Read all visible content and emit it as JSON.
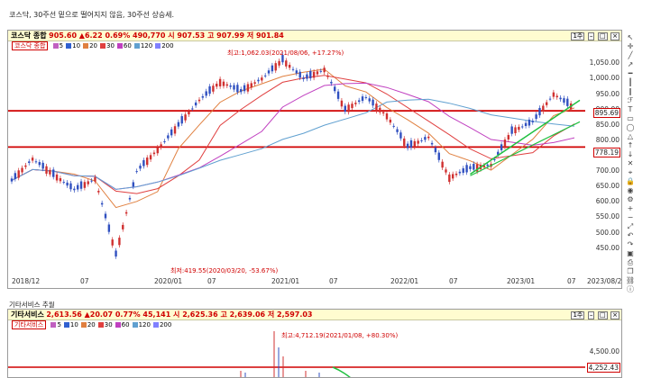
{
  "caption": "코스닥, 30주선 밑으로 떨어지지 않음, 30주선 상승세.",
  "main_chart": {
    "title": "코스닥 종합",
    "quote": "905.60 ▲6.22 0.69% 490,770 시 907.53 고 907.99 저 901.84",
    "period_label": "1주",
    "legend_name": "코스닥 종합",
    "ma_legend": [
      {
        "label": "5",
        "color": "#c060c0"
      },
      {
        "label": "10",
        "color": "#3060d0"
      },
      {
        "label": "20",
        "color": "#e08040"
      },
      {
        "label": "30",
        "color": "#e04040"
      },
      {
        "label": "60",
        "color": "#c040c0"
      },
      {
        "label": "120",
        "color": "#60a0d0"
      },
      {
        "label": "200",
        "color": "#8080ff"
      }
    ],
    "y_ticks": [
      "1,050.00",
      "1,000.00",
      "950.00",
      "900.00",
      "850.00",
      "800.00",
      "750.00",
      "700.00",
      "650.00",
      "600.00",
      "550.00",
      "500.00",
      "450.00"
    ],
    "x_ticks": [
      "2018/12",
      "07",
      "2020/01",
      "07",
      "2021/01",
      "07",
      "2022/01",
      "07",
      "2023/01",
      "07",
      "2023/08/28"
    ],
    "price_label": "895.69",
    "line_label": "778.19",
    "high_annotation": "최고:1,062.03(2021/08/06, +17.27%)",
    "low_annotation": "최저:419.55(2020/03/20, -53.67%)"
  },
  "sub_caption": "기타서비스 추월",
  "sub_chart": {
    "title": "기타서비스",
    "quote": "2,613.56 ▲20.07 0.77% 45,141 시 2,625.36 고 2,639.06 저 2,597.03",
    "period_label": "1주",
    "legend_name": "기타서비스",
    "y_ticks": [
      "4,500.00"
    ],
    "price_label": "4,252.43",
    "high_annotation": "최고:4,712.19(2021/01/08, +80.30%)"
  },
  "chart_data": {
    "type": "line",
    "title": "코스닥 종합",
    "x": [
      "2018/12",
      "2019/03",
      "2019/07",
      "2019/10",
      "2020/01",
      "2020/03",
      "2020/05",
      "2020/07",
      "2020/09",
      "2020/12",
      "2021/01",
      "2021/03",
      "2021/05",
      "2021/08",
      "2021/10",
      "2021/12",
      "2022/01",
      "2022/03",
      "2022/05",
      "2022/07",
      "2022/09",
      "2022/10",
      "2022/12",
      "2023/01",
      "2023/03",
      "2023/05",
      "2023/07",
      "2023/08"
    ],
    "series": [
      {
        "name": "코스닥 종합",
        "values": [
          670,
          740,
          690,
          640,
          675,
          430,
          700,
          770,
          850,
          930,
          990,
          960,
          1000,
          1062,
          1000,
          1030,
          900,
          940,
          880,
          780,
          810,
          680,
          710,
          720,
          830,
          860,
          950,
          905
        ]
      }
    ],
    "ylim": [
      420,
      1080
    ],
    "hlines": [
      895.69,
      778.19
    ],
    "grid": false
  },
  "toolbar_icons": [
    "arrow-icon",
    "crosshair-icon",
    "line-icon",
    "trend-icon",
    "hline-icon",
    "vline-icon",
    "channel-icon",
    "fib-icon",
    "text-icon",
    "rect-icon",
    "ellipse-icon",
    "triangle-icon",
    "arrow-up-icon",
    "arrow-down-icon",
    "delete-icon",
    "magnet-icon",
    "lock-icon",
    "eye-icon",
    "settings-icon",
    "zoom-in-icon",
    "zoom-out-icon",
    "fit-icon",
    "undo-icon",
    "redo-icon",
    "save-icon",
    "print-icon",
    "copy-icon",
    "link-icon",
    "info-icon"
  ]
}
